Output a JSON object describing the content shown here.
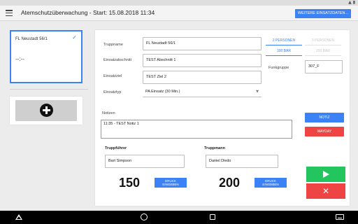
{
  "app": {
    "title": "Atemschutzüberwachung - Start: 15.08.2018 11:34",
    "more_button": "WEITERE EINSATZDATEN..."
  },
  "sidebar": {
    "unit": {
      "name": "FL Neustadt 56/1",
      "time": "--:--"
    },
    "add_label": "add-unit"
  },
  "form": {
    "truppname": {
      "label": "Truppname",
      "value": "FL Neustadt 56/1"
    },
    "einsatzabschnitt": {
      "label": "Einsatzabschnitt",
      "value": "TEST Abschnitt 1"
    },
    "einsatzziel": {
      "label": "Einsatzziel",
      "value": "TEST Ziel 2"
    },
    "einsatztyp": {
      "label": "Einsatztyp",
      "value": "PA Einsatz (30 Min.)"
    },
    "funkgruppe": {
      "label": "Funkgruppe",
      "value": "307_F"
    },
    "persons_toggle": {
      "active": "2 PERSONEN",
      "inactive": "3 PERSONEN"
    },
    "pressure_toggle": {
      "active": "300 BAR",
      "inactive": "200 BAR"
    }
  },
  "notes": {
    "label": "Notizen",
    "value": "11:35 - TEST Notiz 1",
    "notiz_button": "NOTIZ",
    "mayday_button": "MAYDAY"
  },
  "truppfuehrer": {
    "label": "Truppführer",
    "name": "Bart Simpson",
    "pressure": "150",
    "druck_button_line1": "DRUCK",
    "druck_button_line2": "EINGEBEN"
  },
  "truppmann": {
    "label": "Truppmann",
    "name": "Daniel Diedo",
    "pressure": "200",
    "druck_button_line1": "DRUCK",
    "druck_button_line2": "EINGEBEN"
  },
  "colors": {
    "accent": "#3b82f6",
    "start": "#22c55e",
    "stop": "#ef4444"
  }
}
